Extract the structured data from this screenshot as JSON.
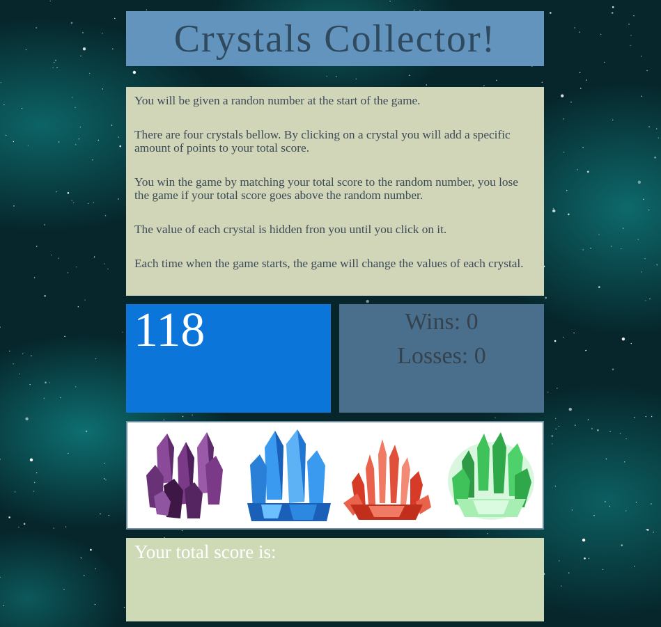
{
  "header": {
    "title": "Crystals Collector!"
  },
  "instructions": {
    "paragraphs": [
      "You will be given a randon number at the start of the game.",
      "There are four crystals bellow. By clicking on a crystal you will add a specific amount of points to your total score.",
      "You win the game by matching your total score to the random number, you lose the game if your total score goes above the random number.",
      "The value of each crystal is hidden fron you until you click on it.",
      "Each time when the game starts, the game will change the values of each crystal."
    ]
  },
  "game": {
    "random_number": "118",
    "wins_text": "Wins: 0",
    "losses_text": "Losses: 0"
  },
  "crystals": [
    {
      "icon": "purple-crystal-icon",
      "color": "#7b3a87"
    },
    {
      "icon": "blue-crystal-icon",
      "color": "#2a7fd6"
    },
    {
      "icon": "red-crystal-icon",
      "color": "#d73a26"
    },
    {
      "icon": "green-crystal-icon",
      "color": "#3fc25a"
    }
  ],
  "score": {
    "label": "Your total score is:",
    "value": ""
  },
  "colors": {
    "header_bg": "#6394bd",
    "instructions_bg": "#d1d6b9",
    "random_bg": "#0b75d9",
    "stats_bg": "#4a6f8c",
    "score_bg": "#cedab5"
  }
}
